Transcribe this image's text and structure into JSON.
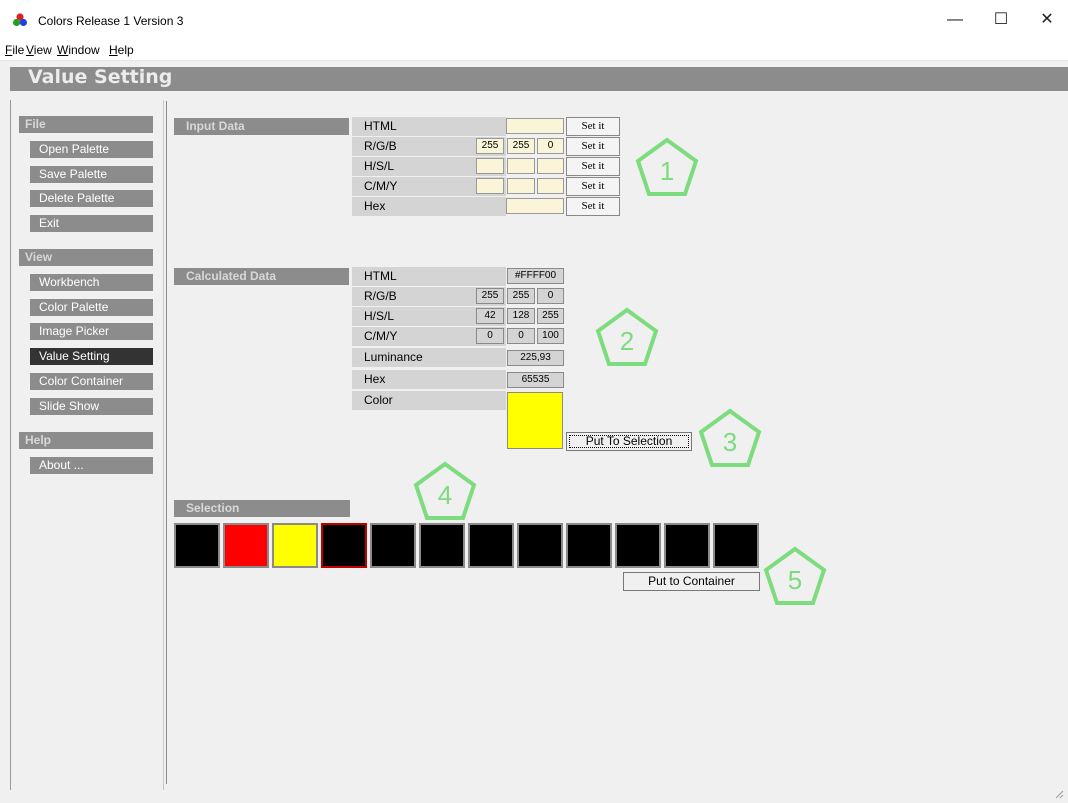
{
  "window": {
    "title": "Colors Release 1 Version 3",
    "controls": {
      "minimize": "—",
      "maximize": "☐",
      "close": "✕"
    }
  },
  "menu": {
    "items": [
      {
        "label": "File",
        "underline": "F",
        "rest": "ile"
      },
      {
        "label": "View",
        "underline": "V",
        "rest": "iew"
      },
      {
        "label": "Window",
        "underline": "W",
        "rest": "indow"
      },
      {
        "label": "Help",
        "underline": "H",
        "rest": "elp"
      }
    ]
  },
  "page": {
    "title": "Value Setting"
  },
  "sidebar": {
    "file": {
      "header": "File",
      "items": [
        "Open Palette",
        "Save Palette",
        "Delete Palette",
        "Exit"
      ]
    },
    "view": {
      "header": "View",
      "items": [
        "Workbench",
        "Color Palette",
        "Image Picker",
        "Value Setting",
        "Color Container",
        "Slide Show"
      ],
      "active": "Value Setting"
    },
    "help": {
      "header": "Help",
      "items": [
        "About ..."
      ]
    }
  },
  "input_data": {
    "header": "Input Data",
    "rows": [
      {
        "label": "HTML",
        "values": [
          ""
        ]
      },
      {
        "label": "R/G/B",
        "values": [
          "255",
          "255",
          "0"
        ]
      },
      {
        "label": "H/S/L",
        "values": [
          "",
          "",
          ""
        ]
      },
      {
        "label": "C/M/Y",
        "values": [
          "",
          "",
          ""
        ]
      },
      {
        "label": "Hex",
        "values": [
          ""
        ]
      }
    ],
    "set_label": "Set it"
  },
  "calculated_data": {
    "header": "Calculated Data",
    "rows": [
      {
        "label": "HTML",
        "values": [
          "#FFFF00"
        ]
      },
      {
        "label": "R/G/B",
        "values": [
          "255",
          "255",
          "0"
        ]
      },
      {
        "label": "H/S/L",
        "values": [
          "42",
          "128",
          "255"
        ]
      },
      {
        "label": "C/M/Y",
        "values": [
          "0",
          "0",
          "100"
        ]
      },
      {
        "label": "Luminance",
        "values": [
          "225,93"
        ]
      },
      {
        "label": "Hex",
        "values": [
          "65535"
        ]
      },
      {
        "label": "Color",
        "values": []
      }
    ],
    "color": "#ffff00",
    "put_to_selection": "Put To Selection"
  },
  "selection": {
    "header": "Selection",
    "swatches": [
      "#000000",
      "#ff0000",
      "#ffff00",
      "#000000",
      "#000000",
      "#000000",
      "#000000",
      "#000000",
      "#000000",
      "#000000",
      "#000000",
      "#000000"
    ],
    "selected_index": 3,
    "put_to_container": "Put to Container"
  },
  "badges": [
    "1",
    "2",
    "3",
    "4",
    "5"
  ],
  "colors": {
    "badge": "#7ddc7d",
    "header_gray": "#8c8c8c",
    "active_nav": "#333333",
    "input_bg": "#faf4d8"
  },
  "icons": {
    "app": "color-dots-icon",
    "resize": "resize-grip-icon"
  }
}
